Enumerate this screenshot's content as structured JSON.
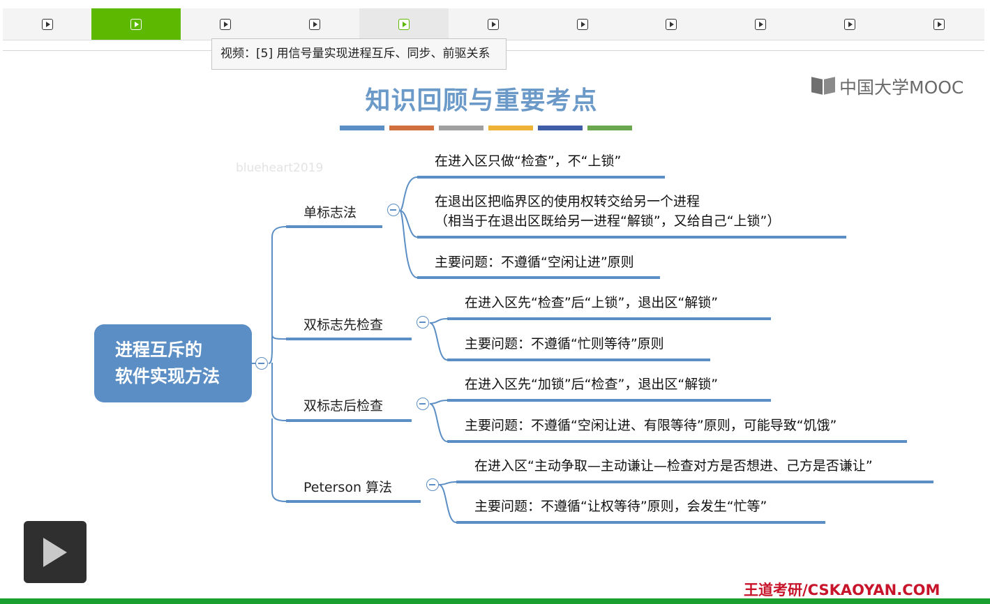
{
  "tabs": {
    "count": 11,
    "active_index": 1,
    "hover_index": 4,
    "icon": "play-square-icon"
  },
  "tooltip": "视频：[5] 用信号量实现进程互斥、同步、前驱关系",
  "logo": "中国大学MOOC",
  "slide_title": "知识回顾与重要考点",
  "color_bar": [
    "#5b8ec5",
    "#d1703e",
    "#a0a0a0",
    "#eeb336",
    "#3e5da6",
    "#6aa84f"
  ],
  "watermark": "blueheart2019",
  "mindmap": {
    "root": [
      "进程互斥的",
      "软件实现方法"
    ],
    "branches": [
      {
        "label": "单标志法",
        "leaves": [
          "在进入区只做“检查”，不“上锁”",
          "在退出区把临界区的使用权转交给另一个进程\n（相当于在退出区既给另一进程“解锁”，又给自己“上锁”）",
          "主要问题：不遵循“空闲让进”原则"
        ]
      },
      {
        "label": "双标志先检查",
        "leaves": [
          "在进入区先“检查”后“上锁”，退出区“解锁”",
          "主要问题：不遵循“忙则等待”原则"
        ]
      },
      {
        "label": "双标志后检查",
        "leaves": [
          "在进入区先“加锁”后“检查”，退出区“解锁”",
          "主要问题：不遵循“空闲让进、有限等待”原则，可能导致“饥饿”"
        ]
      },
      {
        "label": "Peterson 算法",
        "leaves": [
          "在进入区“主动争取—主动谦让—检查对方是否想进、己方是否谦让”",
          "主要问题：不遵循“让权等待”原则，会发生“忙等”"
        ]
      }
    ]
  },
  "brand": "王道考研/CSKAOYAN.COM",
  "player": {
    "play_icon": "play-icon"
  }
}
